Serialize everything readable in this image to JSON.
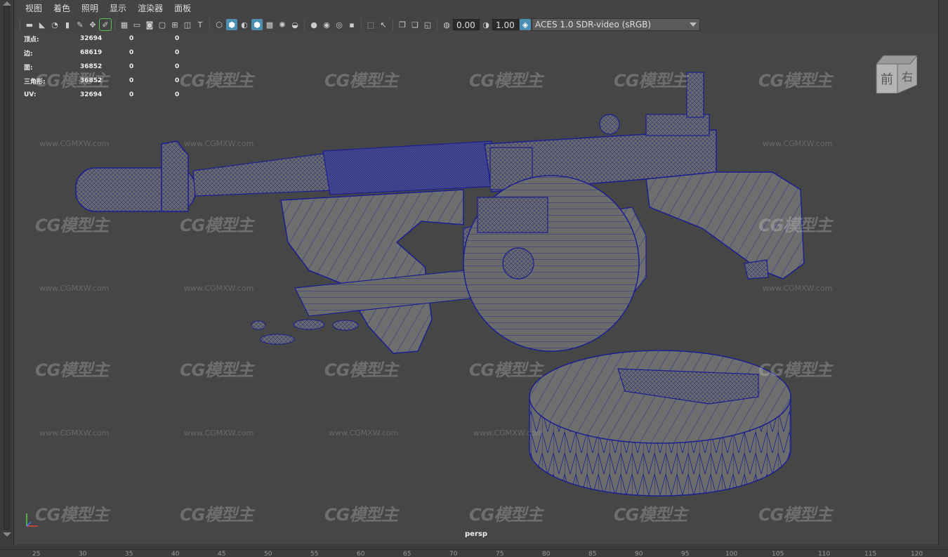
{
  "menubar": {
    "items": [
      "视图",
      "着色",
      "照明",
      "显示",
      "渲染器",
      "面板"
    ]
  },
  "toolbar": {
    "exposure_value": "0.00",
    "gamma_value": "1.00",
    "color_space": "ACES 1.0 SDR-video (sRGB)"
  },
  "hud": {
    "rows": [
      {
        "label": "顶点:",
        "total": "32694",
        "selected": "0",
        "extra": "0"
      },
      {
        "label": "边:",
        "total": "68619",
        "selected": "0",
        "extra": "0"
      },
      {
        "label": "面:",
        "total": "36852",
        "selected": "0",
        "extra": "0"
      },
      {
        "label": "三角形:",
        "total": "36852",
        "selected": "0",
        "extra": "0"
      },
      {
        "label": "UV:",
        "total": "32694",
        "selected": "0",
        "extra": "0"
      }
    ]
  },
  "viewcube": {
    "front": "前",
    "right": "右"
  },
  "viewport": {
    "camera": "persp",
    "watermark": "CG模型主",
    "watermark_url": "www.CGMXW.com",
    "background": "#464646",
    "wire_color": "#1b1f8f"
  },
  "ruler": {
    "ticks": [
      "25",
      "30",
      "35",
      "40",
      "45",
      "50",
      "55",
      "60",
      "65",
      "70",
      "75",
      "80",
      "85",
      "90",
      "95",
      "100",
      "105",
      "110",
      "115",
      "120"
    ]
  }
}
